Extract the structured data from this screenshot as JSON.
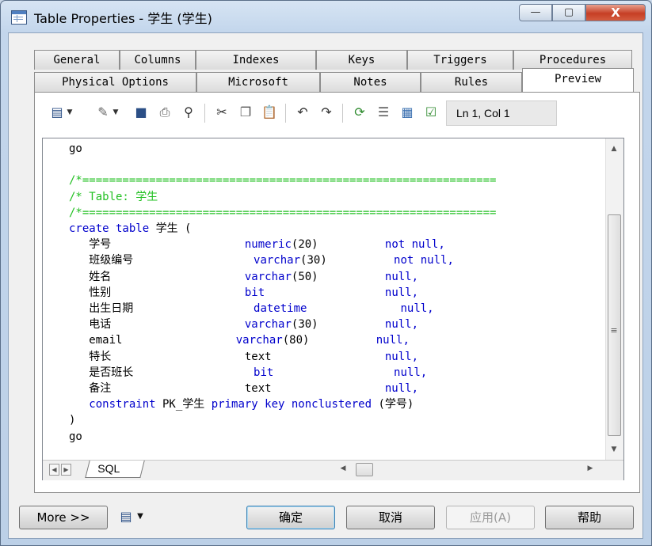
{
  "window": {
    "title": "Table Properties - 学生 (学生)",
    "minimize": "—",
    "maximize": "▢",
    "close": "X"
  },
  "tabs_row1": [
    "General",
    "Columns",
    "Indexes",
    "Keys",
    "Triggers",
    "Procedures"
  ],
  "tabs_row2": [
    "Physical Options",
    "Microsoft",
    "Notes",
    "Rules",
    "Preview"
  ],
  "active_tab": "Preview",
  "toolbar": {
    "position": "Ln 1, Col 1"
  },
  "sql_lines": [
    [
      {
        "t": "go",
        "c": "tx"
      }
    ],
    [],
    [
      {
        "t": "/*==============================================================",
        "c": "cm"
      }
    ],
    [
      {
        "t": "/* Table: 学生",
        "c": "cm"
      }
    ],
    [
      {
        "t": "/*==============================================================",
        "c": "cm"
      }
    ],
    [
      {
        "t": "create table",
        "c": "kw"
      },
      {
        "t": " 学生 (",
        "c": "tx"
      }
    ],
    [
      {
        "t": "   学号                    ",
        "c": "tx"
      },
      {
        "t": "numeric",
        "c": "kw"
      },
      {
        "t": "(20)",
        "c": "tx"
      },
      {
        "t": "          not null,",
        "c": "kw"
      }
    ],
    [
      {
        "t": "   班级编号                  ",
        "c": "tx"
      },
      {
        "t": "varchar",
        "c": "kw"
      },
      {
        "t": "(30)",
        "c": "tx"
      },
      {
        "t": "          not null,",
        "c": "kw"
      }
    ],
    [
      {
        "t": "   姓名                    ",
        "c": "tx"
      },
      {
        "t": "varchar",
        "c": "kw"
      },
      {
        "t": "(50)",
        "c": "tx"
      },
      {
        "t": "          null,",
        "c": "kw"
      }
    ],
    [
      {
        "t": "   性别                    ",
        "c": "tx"
      },
      {
        "t": "bit",
        "c": "kw"
      },
      {
        "t": "                  null,",
        "c": "kw"
      }
    ],
    [
      {
        "t": "   出生日期                  ",
        "c": "tx"
      },
      {
        "t": "datetime",
        "c": "kw"
      },
      {
        "t": "              null,",
        "c": "kw"
      }
    ],
    [
      {
        "t": "   电话                    ",
        "c": "tx"
      },
      {
        "t": "varchar",
        "c": "kw"
      },
      {
        "t": "(30)",
        "c": "tx"
      },
      {
        "t": "          null,",
        "c": "kw"
      }
    ],
    [
      {
        "t": "   email                 ",
        "c": "tx"
      },
      {
        "t": "varchar",
        "c": "kw"
      },
      {
        "t": "(80)",
        "c": "tx"
      },
      {
        "t": "          null,",
        "c": "kw"
      }
    ],
    [
      {
        "t": "   特长                    ",
        "c": "tx"
      },
      {
        "t": "text",
        "c": "tx"
      },
      {
        "t": "                 null,",
        "c": "kw"
      }
    ],
    [
      {
        "t": "   是否班长                  ",
        "c": "tx"
      },
      {
        "t": "bit",
        "c": "kw"
      },
      {
        "t": "                  null,",
        "c": "kw"
      }
    ],
    [
      {
        "t": "   备注                    ",
        "c": "tx"
      },
      {
        "t": "text",
        "c": "tx"
      },
      {
        "t": "                 null,",
        "c": "kw"
      }
    ],
    [
      {
        "t": "   constraint",
        "c": "kw"
      },
      {
        "t": " PK_学生 ",
        "c": "tx"
      },
      {
        "t": "primary key nonclustered",
        "c": "kw"
      },
      {
        "t": " (学号)",
        "c": "tx"
      }
    ],
    [
      {
        "t": ")",
        "c": "tx"
      }
    ],
    [
      {
        "t": "go",
        "c": "tx"
      }
    ]
  ],
  "sheet_tab": "SQL",
  "footer": {
    "more": "More >>",
    "ok": "确定",
    "cancel": "取消",
    "apply": "应用(A)",
    "help": "帮助"
  }
}
